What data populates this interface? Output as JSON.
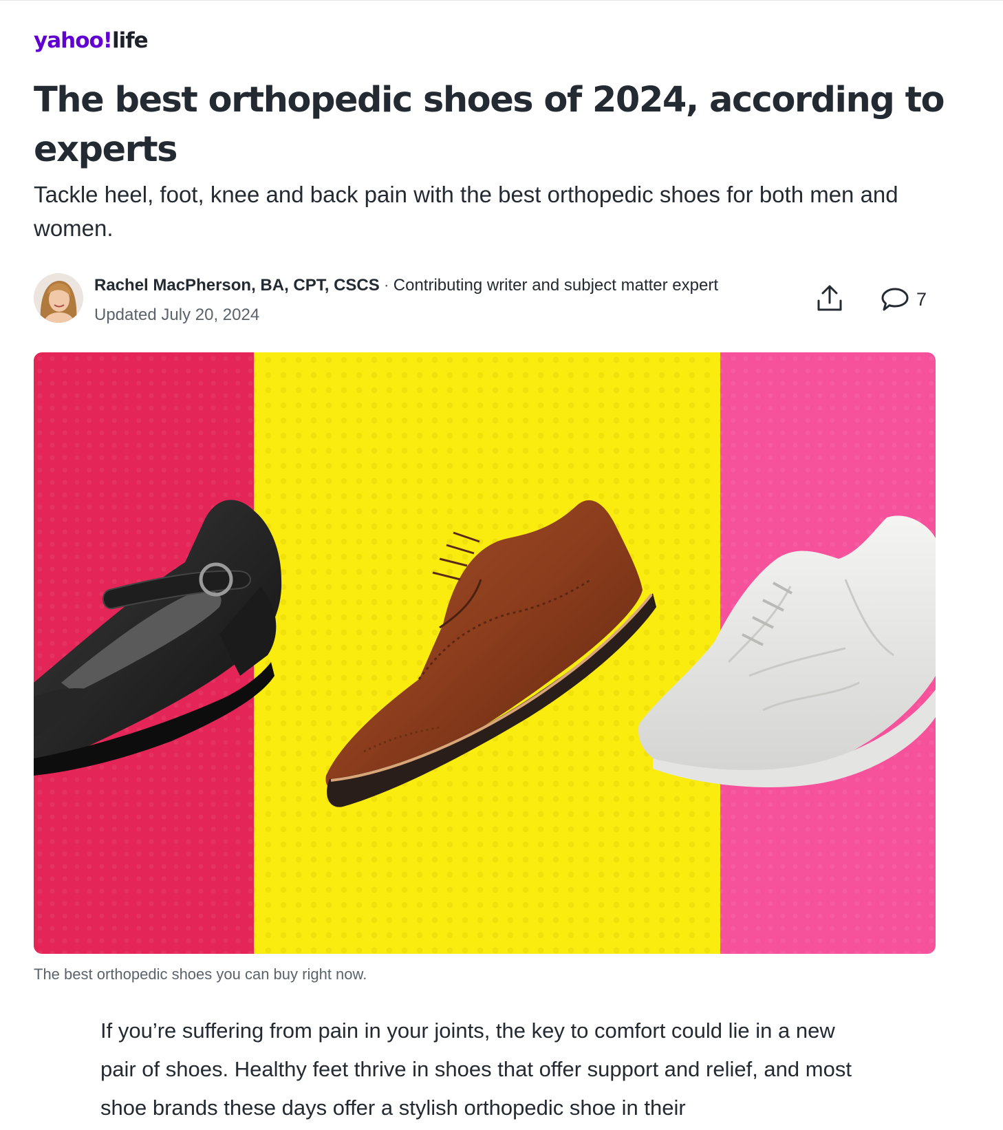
{
  "brand": {
    "logo_main": "yahoo!",
    "logo_section": "life",
    "accent_color": "#6001d2"
  },
  "article": {
    "headline": "The best orthopedic shoes of 2024, according to experts",
    "subheadline": "Tackle heel, foot, knee and back pain with the best orthopedic shoes for both men and women.",
    "author": "Rachel MacPherson, BA, CPT, CSCS",
    "byline_separator": "·",
    "author_role": "Contributing writer and subject matter expert",
    "updated": "Updated July 20, 2024",
    "comment_count": "7",
    "hero_caption": "The best orthopedic shoes you can buy right now.",
    "intro": "If you’re suffering from pain in your joints, the key to comfort could lie in a new pair of shoes. Healthy feet thrive in shoes that offer support and relief, and most shoe brands these days offer a stylish orthopedic shoe in their"
  },
  "hero": {
    "panel_colors": [
      "#e32557",
      "#fbec10",
      "#f6519b"
    ],
    "items": [
      "black-mary-jane-shoe",
      "brown-wingtip-oxford-shoe",
      "white-walking-sneaker"
    ]
  },
  "icons": {
    "share": "share-icon",
    "comment": "comment-icon",
    "avatar": "author-avatar"
  }
}
